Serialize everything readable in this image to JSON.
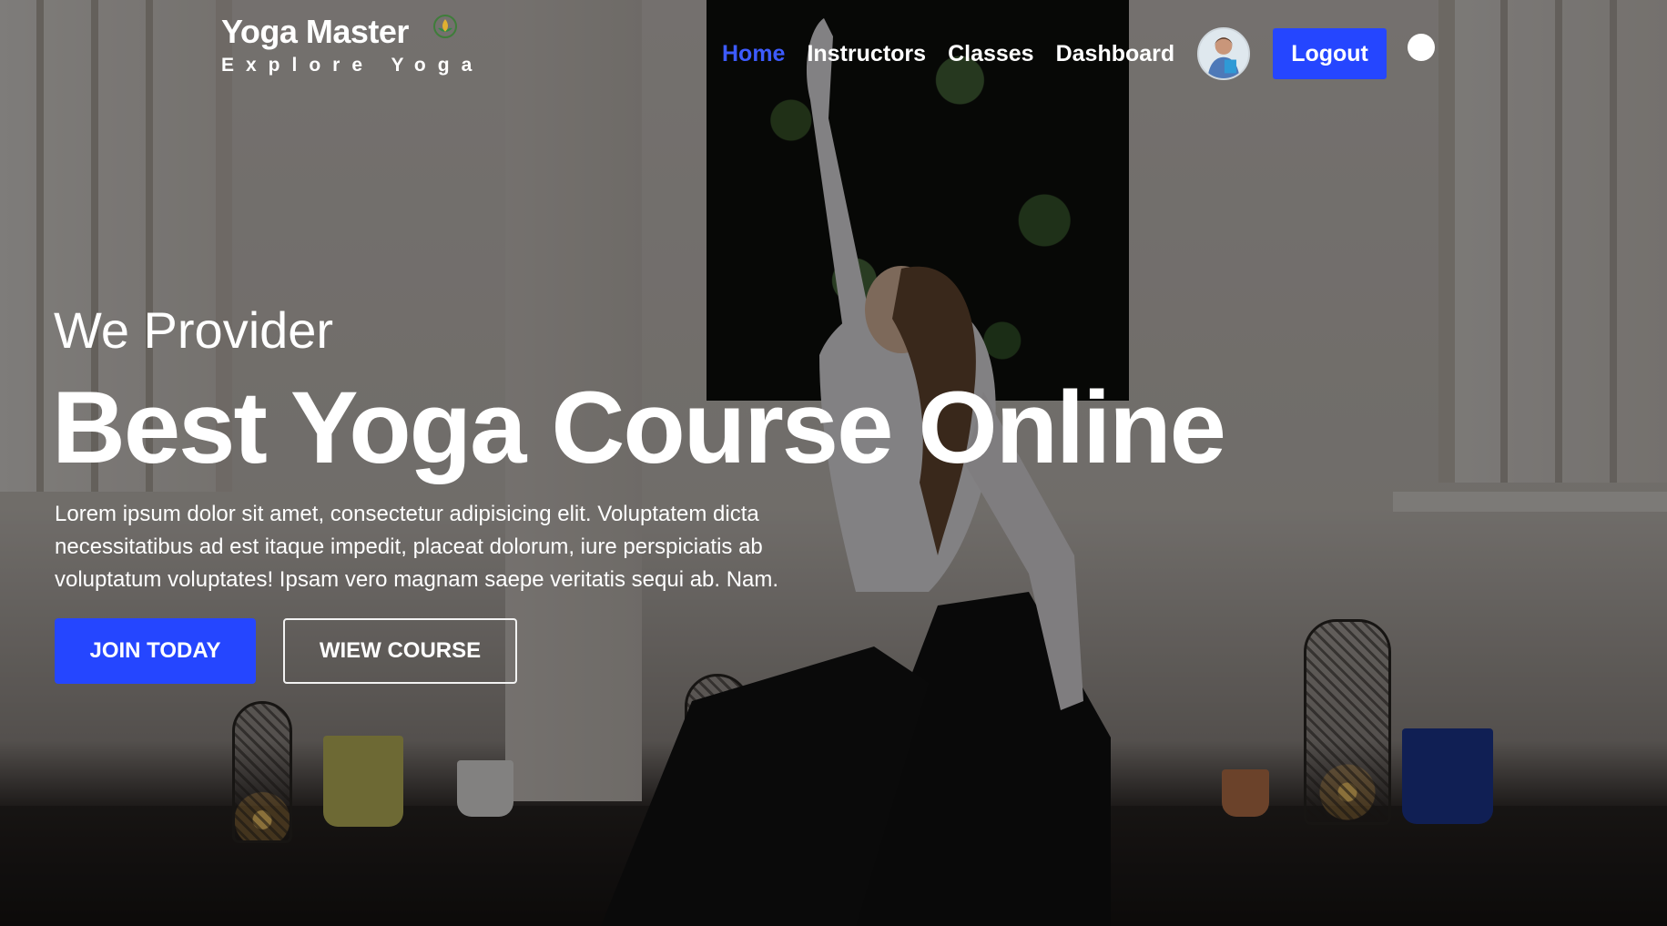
{
  "brand": {
    "title": "Yoga Master",
    "tagline": "Explore Yoga",
    "logo_icon": "lotus-logo-icon"
  },
  "nav": {
    "links": [
      {
        "label": "Home",
        "active": true
      },
      {
        "label": "Instructors",
        "active": false
      },
      {
        "label": "Classes",
        "active": false
      },
      {
        "label": "Dashboard",
        "active": false
      }
    ],
    "avatar_icon": "user-avatar",
    "logout_label": "Logout",
    "theme_toggle_icon": "theme-toggle-icon"
  },
  "hero": {
    "eyebrow": "We Provider",
    "headline": "Best Yoga Course Online",
    "lead": "Lorem ipsum dolor sit amet, consectetur adipisicing elit. Voluptatem dicta necessitatibus ad est itaque impedit, placeat dolorum, iure perspiciatis ab voluptatum voluptates! Ipsam vero magnam saepe veritatis sequi ab. Nam.",
    "primary_cta": "JOIN TODAY",
    "secondary_cta": "WIEW COURSE"
  },
  "colors": {
    "accent": "#2546ff",
    "active_link": "#3d5bff",
    "text": "#ffffff"
  }
}
